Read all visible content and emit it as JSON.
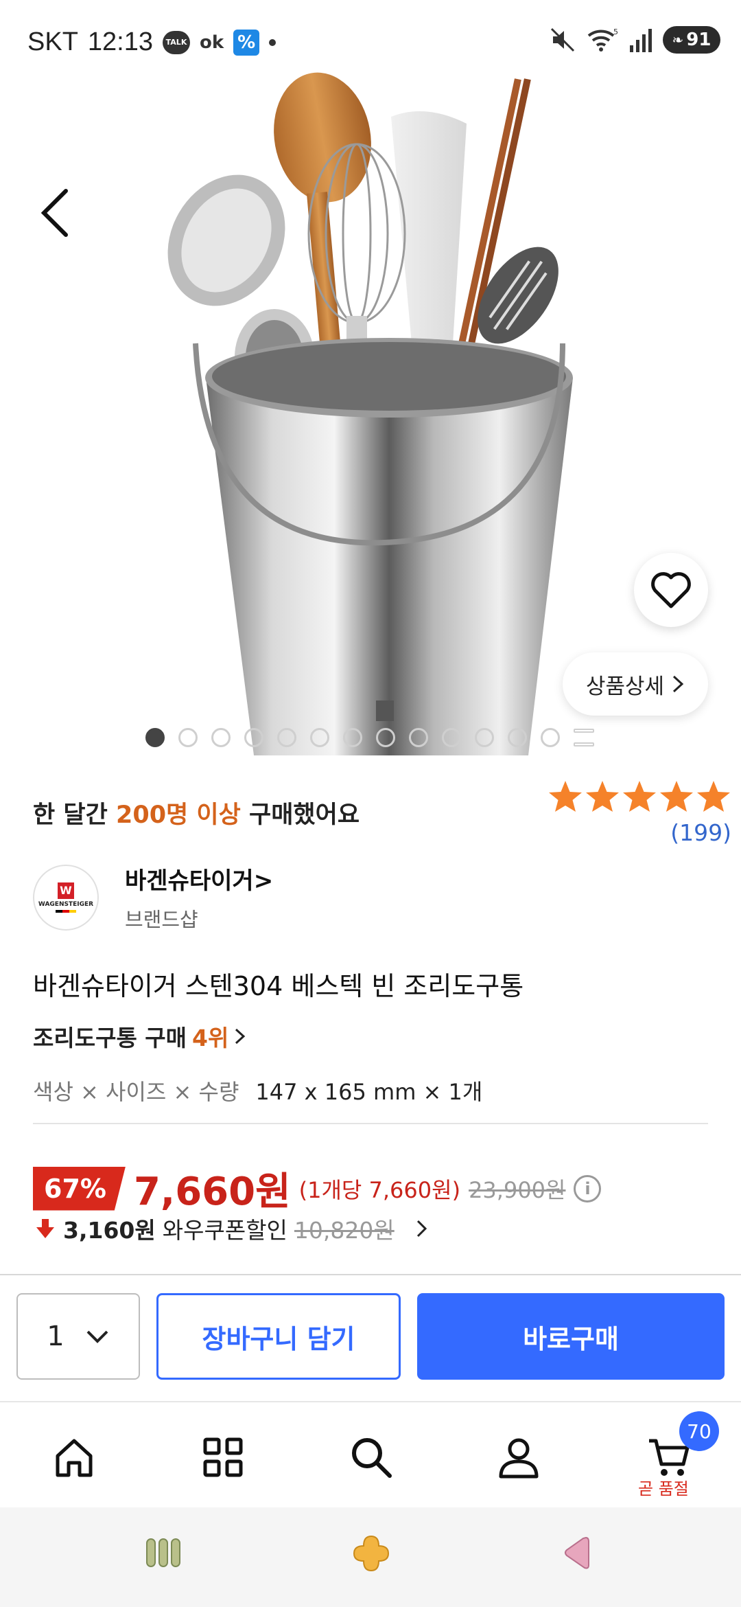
{
  "status_bar": {
    "carrier": "SKT",
    "time": "12:13",
    "talk_label": "TALK",
    "ok_label": "ok",
    "battery": "91"
  },
  "hero": {
    "detail_label": "상품상세",
    "image_count": 14,
    "active_index": 0
  },
  "purchase": {
    "prefix": "한 달간 ",
    "highlight": "200명 이상",
    "suffix": " 구매했어요"
  },
  "rating": {
    "stars": 5,
    "count": "(199)"
  },
  "brand": {
    "name": "바겐슈타이거",
    "sub": "브랜드샵",
    "logo_text": "WAGENSTEIGER",
    "logo_mark": "W"
  },
  "product": {
    "title": "바겐슈타이거 스텐304 베스텍 빈 조리도구통",
    "rank_prefix": "조리도구통 구매 ",
    "rank_value": "4위",
    "option_label": "색상 × 사이즈 × 수량",
    "option_value": "147 x 165 mm × 1개"
  },
  "price": {
    "discount": "67%",
    "price": "7,660원",
    "unit_price": "(1개당 7,660원)",
    "original": "23,900원",
    "coupon_amount": "3,160원",
    "coupon_label": "와우쿠폰할인",
    "coupon_original": "10,820원"
  },
  "actions": {
    "quantity": "1",
    "cart_label": "장바구니 담기",
    "buy_label": "바로구매"
  },
  "bottom_nav": {
    "cart_badge": "70",
    "soldout_label": "곧 품절"
  },
  "colors": {
    "accent": "#346aff",
    "discount": "#d8291c",
    "highlight": "#d4621b",
    "star": "#f5822a"
  }
}
